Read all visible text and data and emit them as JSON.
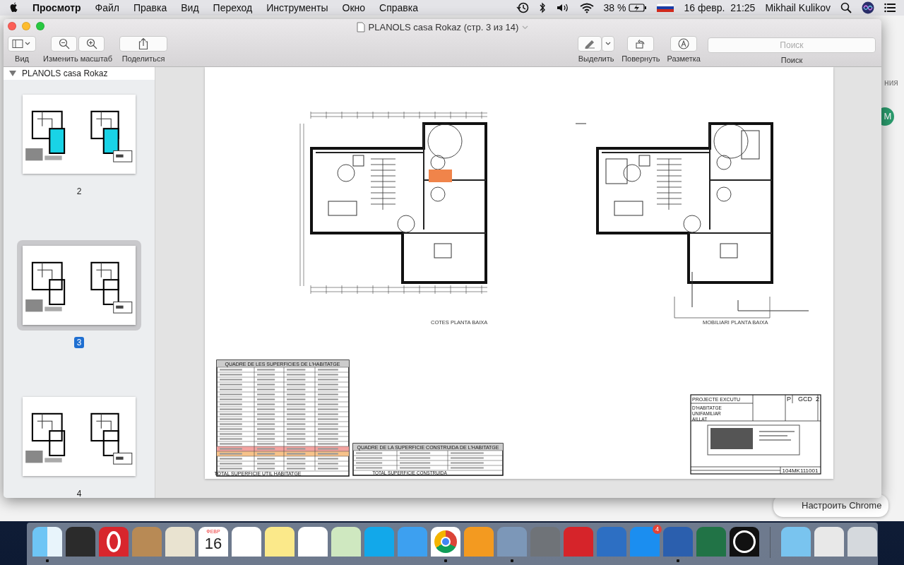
{
  "menu_bar": {
    "app_name": "Просмотр",
    "menus": [
      "Файл",
      "Правка",
      "Вид",
      "Переход",
      "Инструменты",
      "Окно",
      "Справка"
    ],
    "battery": "38 %",
    "date": "16 февр.",
    "time": "21:25",
    "user": "Mikhail Kulikov"
  },
  "background_window": {
    "sidebar_text": "ния",
    "avatar_letter": "M",
    "button": "Настроить Chrome"
  },
  "window": {
    "title": "PLANOLS casa Rokaz (стр. 3 из 14)",
    "toolbar_left": [
      {
        "kind": "view",
        "label": "Вид"
      },
      {
        "kind": "zoom",
        "label": "Изменить масштаб"
      },
      {
        "kind": "share",
        "label": "Поделиться"
      }
    ],
    "toolbar_right": [
      {
        "kind": "highlight",
        "label": "Выделить"
      },
      {
        "kind": "rotate",
        "label": "Повернуть"
      },
      {
        "kind": "markup",
        "label": "Разметка"
      },
      {
        "kind": "search",
        "label": "Поиск",
        "placeholder": "Поиск"
      }
    ],
    "sidebar": {
      "document": "PLANOLS casa Rokaz",
      "expanded": true,
      "pages": [
        {
          "number": "2",
          "selected": false
        },
        {
          "number": "3",
          "selected": true
        },
        {
          "number": "4",
          "selected": false
        }
      ]
    },
    "page": {
      "captions": [
        "COTES PLANTA BAIXA",
        "MOBILIARI PLANTA BAIXA"
      ],
      "tables": [
        {
          "title": "QUADRE DE LES SUPERFICIES DE L'HABITATGE",
          "total": "TOTAL SUPERFICIE UTIL HABITATGE"
        },
        {
          "title": "QUADRE DE LA SUPERFICIE CONSTRUIDA DE L'HABITATGE",
          "total": "TOTAL SUPERFICIE CONSTRUIDA"
        }
      ],
      "title_block": {
        "project": "PROJECTE EXCUTU",
        "description": "D'HABITATGE UNIFAMILIAR AILLAT",
        "sheet_letter": "P",
        "code": "GCD",
        "sheet_number": "2",
        "reference": "104MK111001"
      }
    }
  },
  "dock": {
    "items": [
      {
        "running": true
      },
      {
        "running": false
      },
      {
        "running": false
      },
      {
        "running": false
      },
      {
        "running": false
      },
      {
        "running": false,
        "month": "ФЕВР",
        "day": "16"
      },
      {
        "running": false
      },
      {
        "running": false
      },
      {
        "running": false
      },
      {
        "running": false
      },
      {
        "running": false
      },
      {
        "running": false
      },
      {
        "running": true
      },
      {
        "running": false
      },
      {
        "running": true
      },
      {
        "running": false
      },
      {
        "running": false
      },
      {
        "running": false
      },
      {
        "running": false,
        "badge": "4"
      },
      {
        "running": true
      },
      {
        "running": false
      },
      {
        "running": false
      },
      {
        "running": false
      },
      {
        "running": false
      },
      {
        "running": false
      }
    ]
  }
}
